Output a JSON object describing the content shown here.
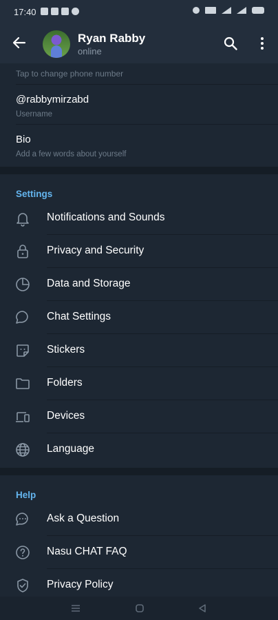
{
  "statusbar": {
    "time": "17:40"
  },
  "appbar": {
    "name": "Ryan Rabby",
    "status": "online"
  },
  "account": {
    "phone_hint": "Tap to change phone number",
    "username_value": "@rabbymirzabd",
    "username_label": "Username",
    "bio_value": "Bio",
    "bio_hint": "Add a few words about yourself"
  },
  "settings": {
    "header": "Settings",
    "items": [
      {
        "label": "Notifications and Sounds",
        "icon": "bell-icon"
      },
      {
        "label": "Privacy and Security",
        "icon": "lock-icon"
      },
      {
        "label": "Data and Storage",
        "icon": "pie-chart-icon"
      },
      {
        "label": "Chat Settings",
        "icon": "chat-bubble-icon"
      },
      {
        "label": "Stickers",
        "icon": "sticker-icon"
      },
      {
        "label": "Folders",
        "icon": "folder-icon"
      },
      {
        "label": "Devices",
        "icon": "devices-icon"
      },
      {
        "label": "Language",
        "icon": "globe-icon"
      }
    ]
  },
  "help": {
    "header": "Help",
    "items": [
      {
        "label": "Ask a Question",
        "icon": "speech-bubble-icon"
      },
      {
        "label": "Nasu CHAT FAQ",
        "icon": "question-icon"
      },
      {
        "label": "Privacy Policy",
        "icon": "shield-check-icon"
      }
    ]
  },
  "colors": {
    "background": "#1d2733",
    "header": "#232e3c",
    "accent": "#64b5ef",
    "hint": "#6d7b89"
  }
}
